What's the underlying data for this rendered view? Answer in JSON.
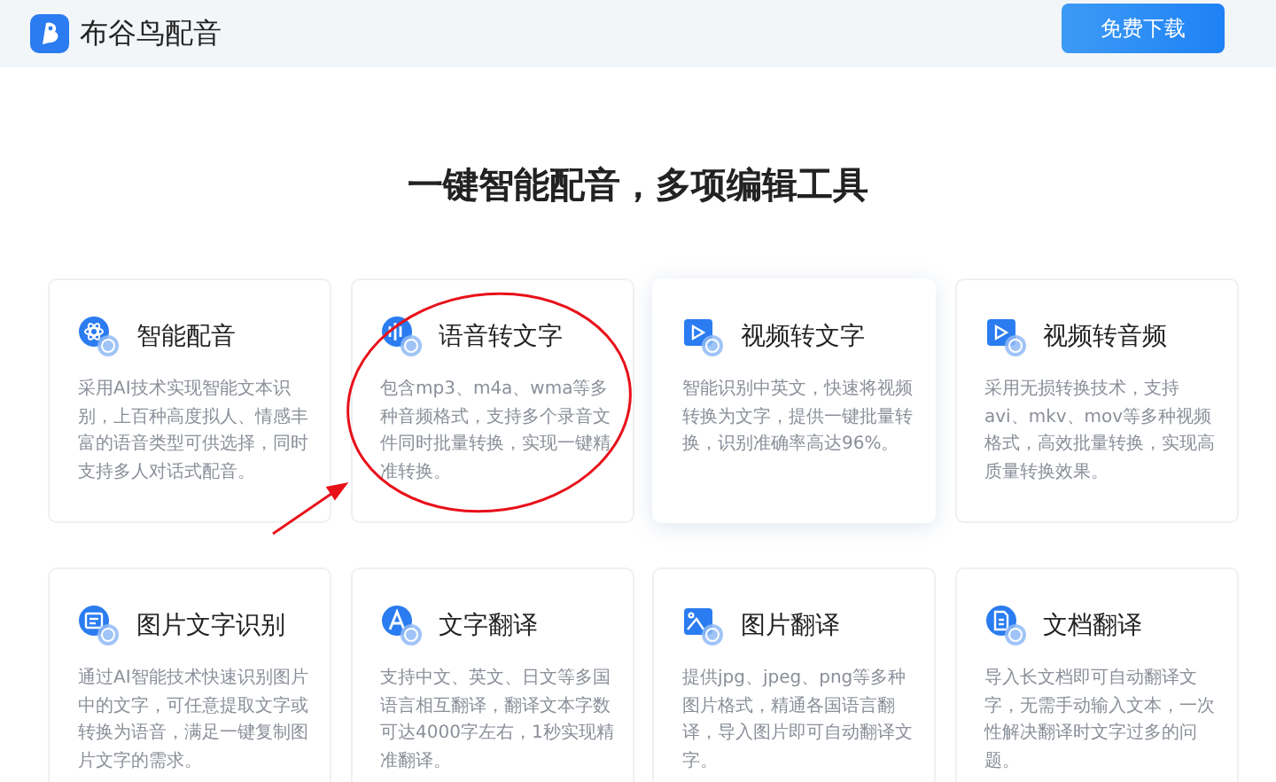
{
  "header": {
    "brand": "布谷鸟配音",
    "download_button": "免费下载"
  },
  "headline": "一键智能配音，多项编辑工具",
  "features": [
    {
      "kind": "dubbing",
      "title": "智能配音",
      "description": "采用AI技术实现智能文本识别，上百种高度拟人、情感丰富的语音类型可供选择，同时支持多人对话式配音。",
      "highlighted": false
    },
    {
      "kind": "speech-to-text",
      "title": "语音转文字",
      "description": "包含mp3、m4a、wma等多种音频格式，支持多个录音文件同时批量转换，实现一键精准转换。",
      "highlighted": false
    },
    {
      "kind": "video-to-text",
      "title": "视频转文字",
      "description": "智能识别中英文，快速将视频转换为文字，提供一键批量转换，识别准确率高达96%。",
      "highlighted": true
    },
    {
      "kind": "video-to-audio",
      "title": "视频转音频",
      "description": "采用无损转换技术，支持avi、mkv、mov等多种视频格式，高效批量转换，实现高质量转换效果。",
      "highlighted": false
    },
    {
      "kind": "image-ocr",
      "title": "图片文字识别",
      "description": "通过AI智能技术快速识别图片中的文字，可任意提取文字或转换为语音，满足一键复制图片文字的需求。",
      "highlighted": false
    },
    {
      "kind": "text-translate",
      "title": "文字翻译",
      "description": "支持中文、英文、日文等多国语言相互翻译，翻译文本字数可达4000字左右，1秒实现精准翻译。",
      "highlighted": false
    },
    {
      "kind": "image-translate",
      "title": "图片翻译",
      "description": "提供jpg、jpeg、png等多种图片格式，精通各国语言翻译，导入图片即可自动翻译文字。",
      "highlighted": false
    },
    {
      "kind": "doc-translate",
      "title": "文档翻译",
      "description": "导入长文档即可自动翻译文字，无需手动输入文本，一次性解决翻译时文字过多的问题。",
      "highlighted": false
    }
  ]
}
